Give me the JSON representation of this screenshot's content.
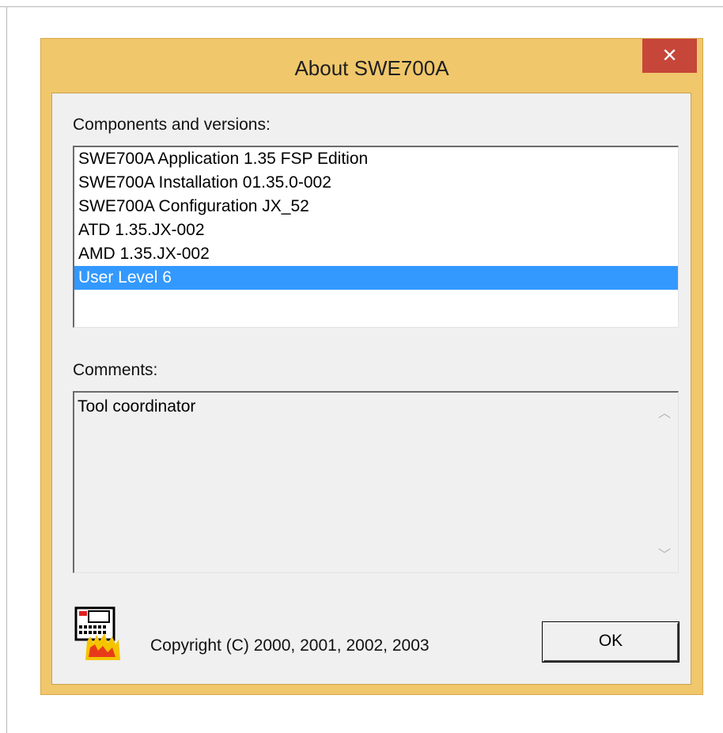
{
  "window": {
    "title": "About SWE700A",
    "close_glyph": "✕",
    "accent_color": "#f0c76b",
    "close_color": "#c7463a"
  },
  "components": {
    "label": "Components and versions:",
    "items": [
      "SWE700A Application 1.35 FSP Edition",
      "SWE700A Installation 01.35.0-002",
      "SWE700A Configuration JX_52",
      "ATD 1.35.JX-002",
      "AMD 1.35.JX-002",
      "User Level 6"
    ],
    "selected_index": 5,
    "selection_color": "#3399ff"
  },
  "comments": {
    "label": "Comments:",
    "text": "Tool coordinator",
    "scroll_up_glyph": "︿",
    "scroll_down_glyph": "﹀"
  },
  "footer": {
    "icon": "app-device-icon",
    "copyright": "Copyright (C) 2000, 2001, 2002, 2003",
    "ok_label": "OK"
  }
}
